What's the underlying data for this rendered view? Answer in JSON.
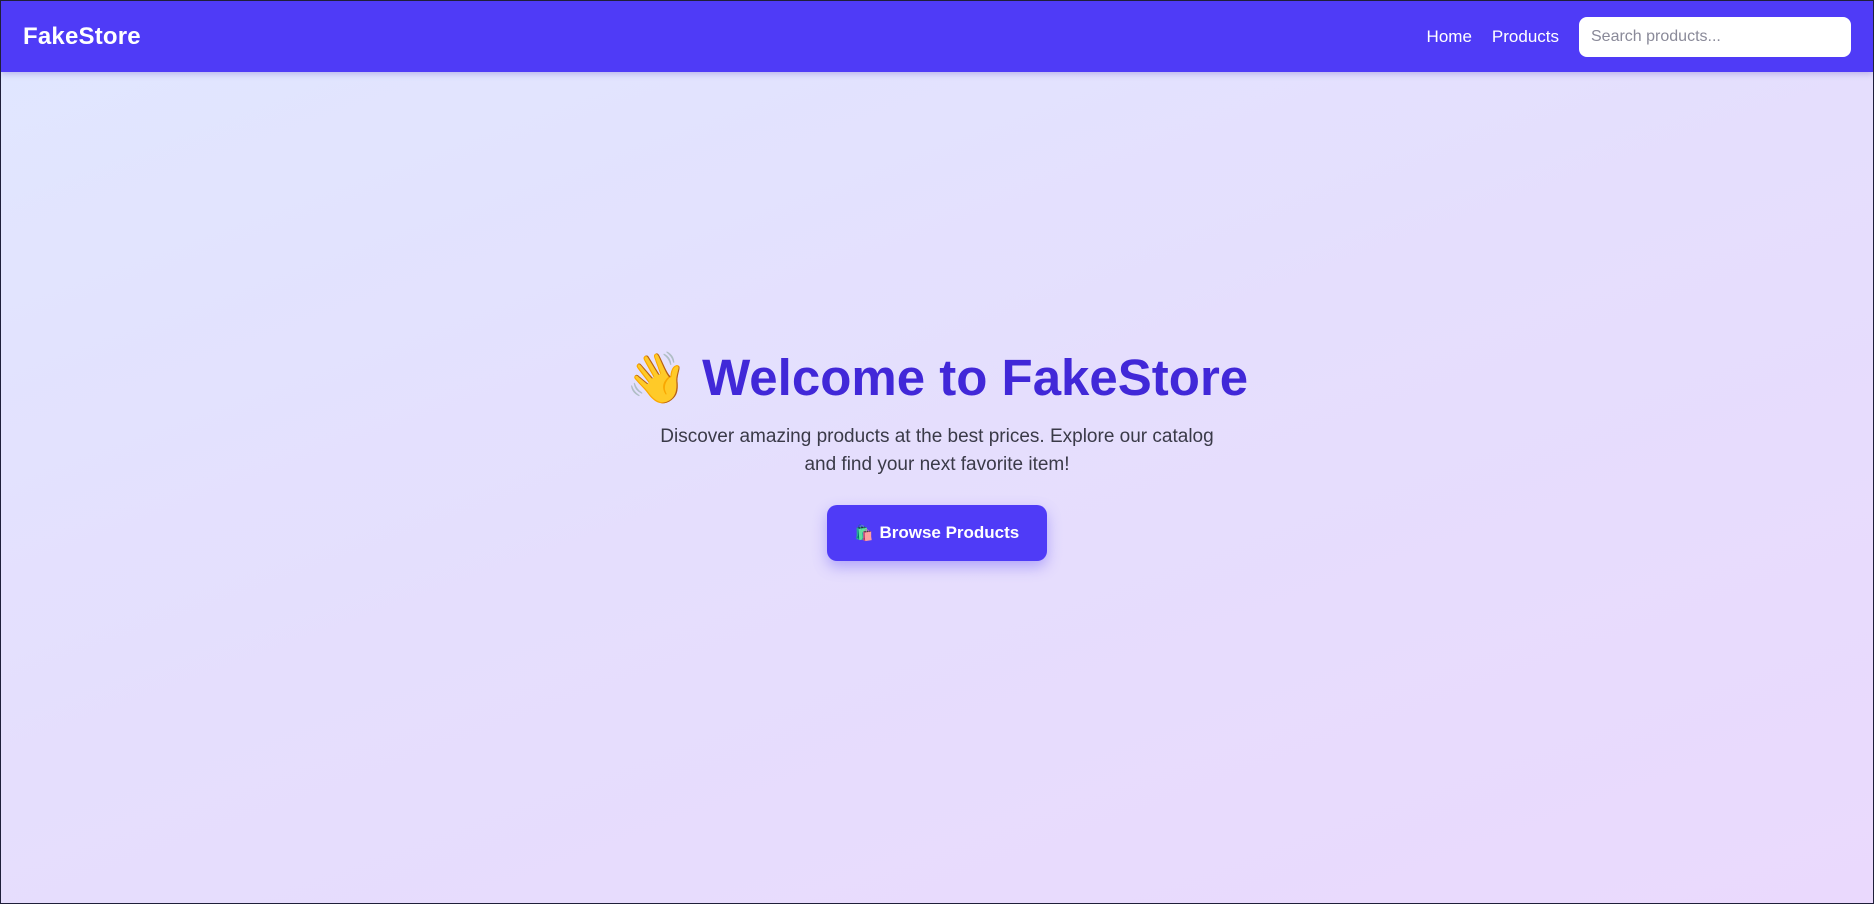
{
  "navbar": {
    "brand": "FakeStore",
    "links": [
      {
        "label": "Home"
      },
      {
        "label": "Products"
      }
    ],
    "search": {
      "placeholder": "Search products..."
    }
  },
  "hero": {
    "title_emoji": "👋",
    "title": "Welcome to FakeStore",
    "description": "Discover amazing products at the best prices. Explore our catalog and find your next favorite item!",
    "cta": {
      "icon": "🛍️",
      "label": "Browse Products"
    }
  },
  "colors": {
    "primary": "#4f3bf7",
    "title": "#4128d8",
    "background_start": "#e0e7ff",
    "background_end": "#ead9fd"
  }
}
